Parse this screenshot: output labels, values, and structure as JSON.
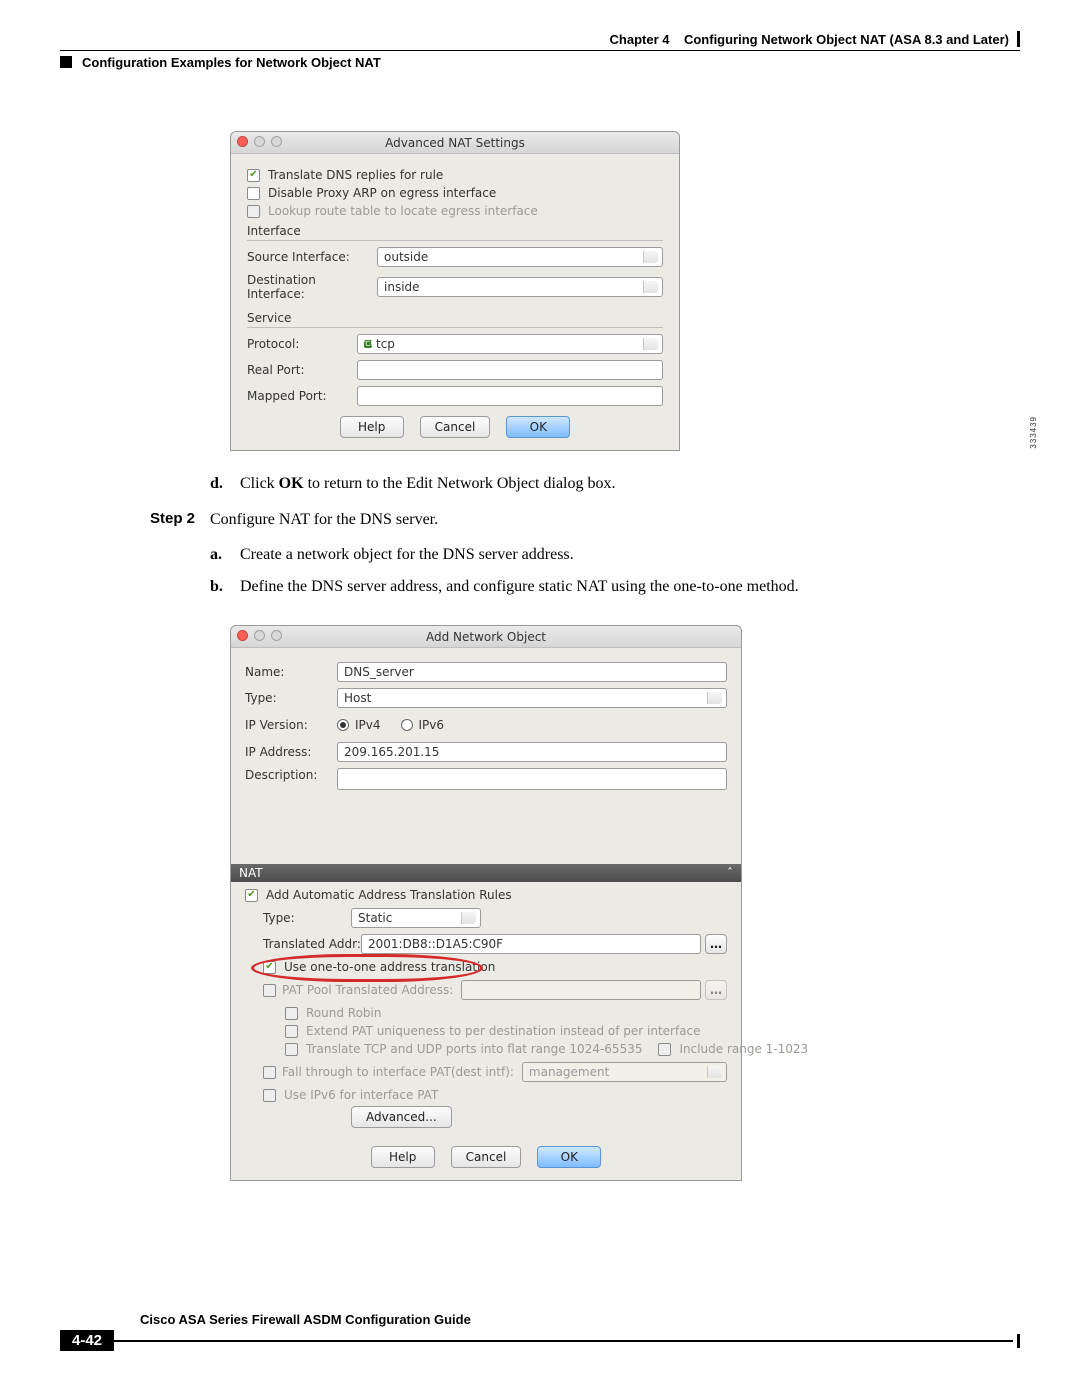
{
  "header": {
    "chapter_prefix": "Chapter 4",
    "chapter_title": "Configuring Network Object NAT (ASA 8.3 and Later)",
    "section_title": "Configuration Examples for Network Object NAT"
  },
  "dialog1": {
    "title": "Advanced NAT Settings",
    "chk_translate_dns": "Translate DNS replies for rule",
    "chk_disable_proxy": "Disable Proxy ARP on egress interface",
    "chk_lookup_route": "Lookup route table to locate egress interface",
    "section_interface": "Interface",
    "lbl_src_if": "Source Interface:",
    "val_src_if": "outside",
    "lbl_dst_if": "Destination Interface:",
    "val_dst_if": "inside",
    "section_service": "Service",
    "lbl_protocol": "Protocol:",
    "val_protocol": "tcp",
    "lbl_real_port": "Real Port:",
    "lbl_mapped_port": "Mapped Port:",
    "btn_help": "Help",
    "btn_cancel": "Cancel",
    "btn_ok": "OK",
    "side_tag": "333439"
  },
  "steps": {
    "d_marker": "d.",
    "d_prefix": "Click ",
    "d_bold": "OK",
    "d_suffix": " to return to the Edit Network Object dialog box.",
    "step2_lbl": "Step 2",
    "step2_text": "Configure NAT for the DNS server.",
    "a_marker": "a.",
    "a_text": "Create a network object for the DNS server address.",
    "b_marker": "b.",
    "b_text": "Define the DNS server address, and configure static NAT using the one-to-one method."
  },
  "dialog2": {
    "title": "Add Network Object",
    "lbl_name": "Name:",
    "val_name": "DNS_server",
    "lbl_type": "Type:",
    "val_type": "Host",
    "lbl_ipver": "IP Version:",
    "ipv4": "IPv4",
    "ipv6": "IPv6",
    "lbl_ipaddr": "IP Address:",
    "val_ipaddr": "209.165.201.15",
    "lbl_desc": "Description:",
    "nat_hdr": "NAT",
    "chk_auto_rules": "Add Automatic Address Translation Rules",
    "lbl_nat_type": "Type:",
    "val_nat_type": "Static",
    "lbl_trans_addr": "Translated Addr:",
    "val_trans_addr": "2001:DB8::D1A5:C90F",
    "chk_one_to_one": "Use one-to-one address translation",
    "lbl_pat_pool": "PAT Pool Translated Address:",
    "chk_round_robin": "Round Robin",
    "chk_extend_pat": "Extend PAT uniqueness to per destination instead of per interface",
    "chk_flat_range": "Translate TCP and UDP ports into flat range 1024-65535",
    "chk_include_range": "Include range 1-1023",
    "chk_fallthrough": "Fall through to interface PAT(dest intf):",
    "val_fallthrough": "management",
    "chk_ipv6_pat": "Use IPv6 for interface PAT",
    "btn_advanced": "Advanced...",
    "btn_help": "Help",
    "btn_cancel": "Cancel",
    "btn_ok": "OK"
  },
  "footer": {
    "guide": "Cisco ASA Series Firewall ASDM Configuration Guide",
    "page": "4-42"
  }
}
